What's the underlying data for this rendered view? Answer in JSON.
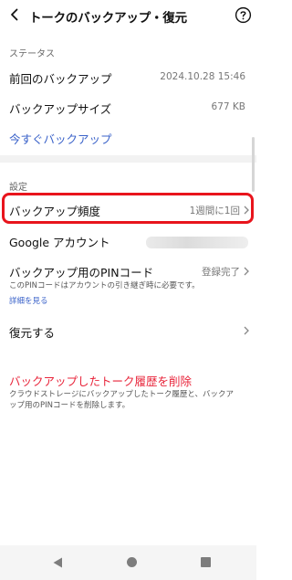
{
  "header": {
    "title": "トークのバックアップ・復元"
  },
  "status_section": {
    "label": "ステータス",
    "last_backup_label": "前回のバックアップ",
    "last_backup_value": "2024.10.28 15:46",
    "backup_size_label": "バックアップサイズ",
    "backup_size_value": "677 KB",
    "backup_now_link": "今すぐバックアップ"
  },
  "settings_section": {
    "label": "設定",
    "frequency_label": "バックアップ頻度",
    "frequency_value": "1週間に1回",
    "google_account_label": "Google アカウント",
    "pin_label": "バックアップ用のPINコード",
    "pin_value": "登録完了",
    "pin_note": "このPINコードはアカウントの引き継ぎ時に必要です。",
    "pin_details_link": "詳細を見る",
    "restore_label": "復元する"
  },
  "delete_section": {
    "label": "バックアップしたトーク履歴を削除",
    "note_line1": "クラウドストレージにバックアップしたトーク履歴と、バックア",
    "note_line2": "ップ用のPINコードを削除します。"
  },
  "colors": {
    "link": "#3a62c9",
    "danger": "#e8243a",
    "highlight": "#e8141c"
  }
}
